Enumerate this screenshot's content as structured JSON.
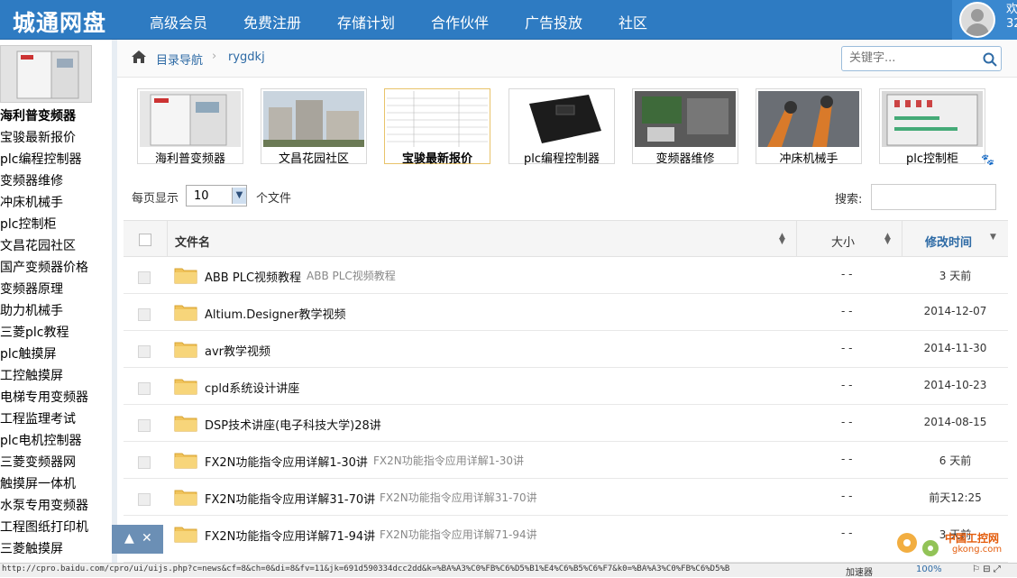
{
  "header": {
    "logo": "城通网盘",
    "nav": [
      "高级会员",
      "免费注册",
      "存储计划",
      "合作伙伴",
      "广告投放",
      "社区"
    ],
    "welcome": "欢 32"
  },
  "sidebar": {
    "top_title": "海利普变频器",
    "items": [
      "宝骏最新报价",
      "plc编程控制器",
      "变频器维修",
      "冲床机械手",
      "plc控制柜",
      "文昌花园社区",
      "国产变频器价格",
      "变频器原理",
      "助力机械手",
      "三菱plc教程",
      "plc触摸屏",
      "工控触摸屏",
      "电梯专用变频器",
      "工程监理考试",
      "plc电机控制器",
      "三菱变频器网",
      "触摸屏一体机",
      "水泵专用变频器",
      "工程图纸打印机",
      "三菱触摸屏"
    ]
  },
  "breadcrumb": {
    "root": "目录导航",
    "separator": "›",
    "current": "rygdkj"
  },
  "search": {
    "placeholder": "关键字..."
  },
  "thumbs": [
    "海利普变频器",
    "文昌花园社区",
    "宝骏最新报价",
    "plc编程控制器",
    "变频器维修",
    "冲床机械手",
    "plc控制柜"
  ],
  "listing": {
    "per_page_label": "每页显示",
    "per_page_value": "10",
    "per_page_suffix": "个文件",
    "filter_label": "搜索:"
  },
  "table": {
    "headers": {
      "name": "文件名",
      "size": "大小",
      "modified": "修改时间"
    },
    "rows": [
      {
        "name": "ABB PLC视频教程",
        "desc": "ABB PLC视频教程",
        "size": "- -",
        "date": "3 天前"
      },
      {
        "name": "Altium.Designer教学视频",
        "desc": "",
        "size": "- -",
        "date": "2014-12-07"
      },
      {
        "name": "avr教学视频",
        "desc": "",
        "size": "- -",
        "date": "2014-11-30"
      },
      {
        "name": "cpld系统设计讲座",
        "desc": "",
        "size": "- -",
        "date": "2014-10-23"
      },
      {
        "name": "DSP技术讲座(电子科技大学)28讲",
        "desc": "",
        "size": "- -",
        "date": "2014-08-15"
      },
      {
        "name": "FX2N功能指令应用详解1-30讲",
        "desc": "FX2N功能指令应用详解1-30讲",
        "size": "- -",
        "date": "6 天前"
      },
      {
        "name": "FX2N功能指令应用详解31-70讲",
        "desc": "FX2N功能指令应用详解31-70讲",
        "size": "- -",
        "date": "前天12:25"
      },
      {
        "name": "FX2N功能指令应用详解71-94讲",
        "desc": "FX2N功能指令应用详解71-94讲",
        "size": "- -",
        "date": "3 天前"
      }
    ]
  },
  "float_ctrl": {
    "up": "▲",
    "close": "✕"
  },
  "statusbar": {
    "url": "http://cpro.baidu.com/cpro/ui/uijs.php?c=news&cf=8&ch=0&di=8&fv=11&jk=691d590334dcc2dd&k=%BA%A3%C0%FB%C6%D5%B1%E4%C6%B5%C6%F7&k0=%BA%A3%C0%FB%C6%D5%B",
    "accelerator": "加速器",
    "zoom": "100%"
  },
  "watermark": {
    "line1": "中国工控网",
    "line2": "gkong.com"
  }
}
